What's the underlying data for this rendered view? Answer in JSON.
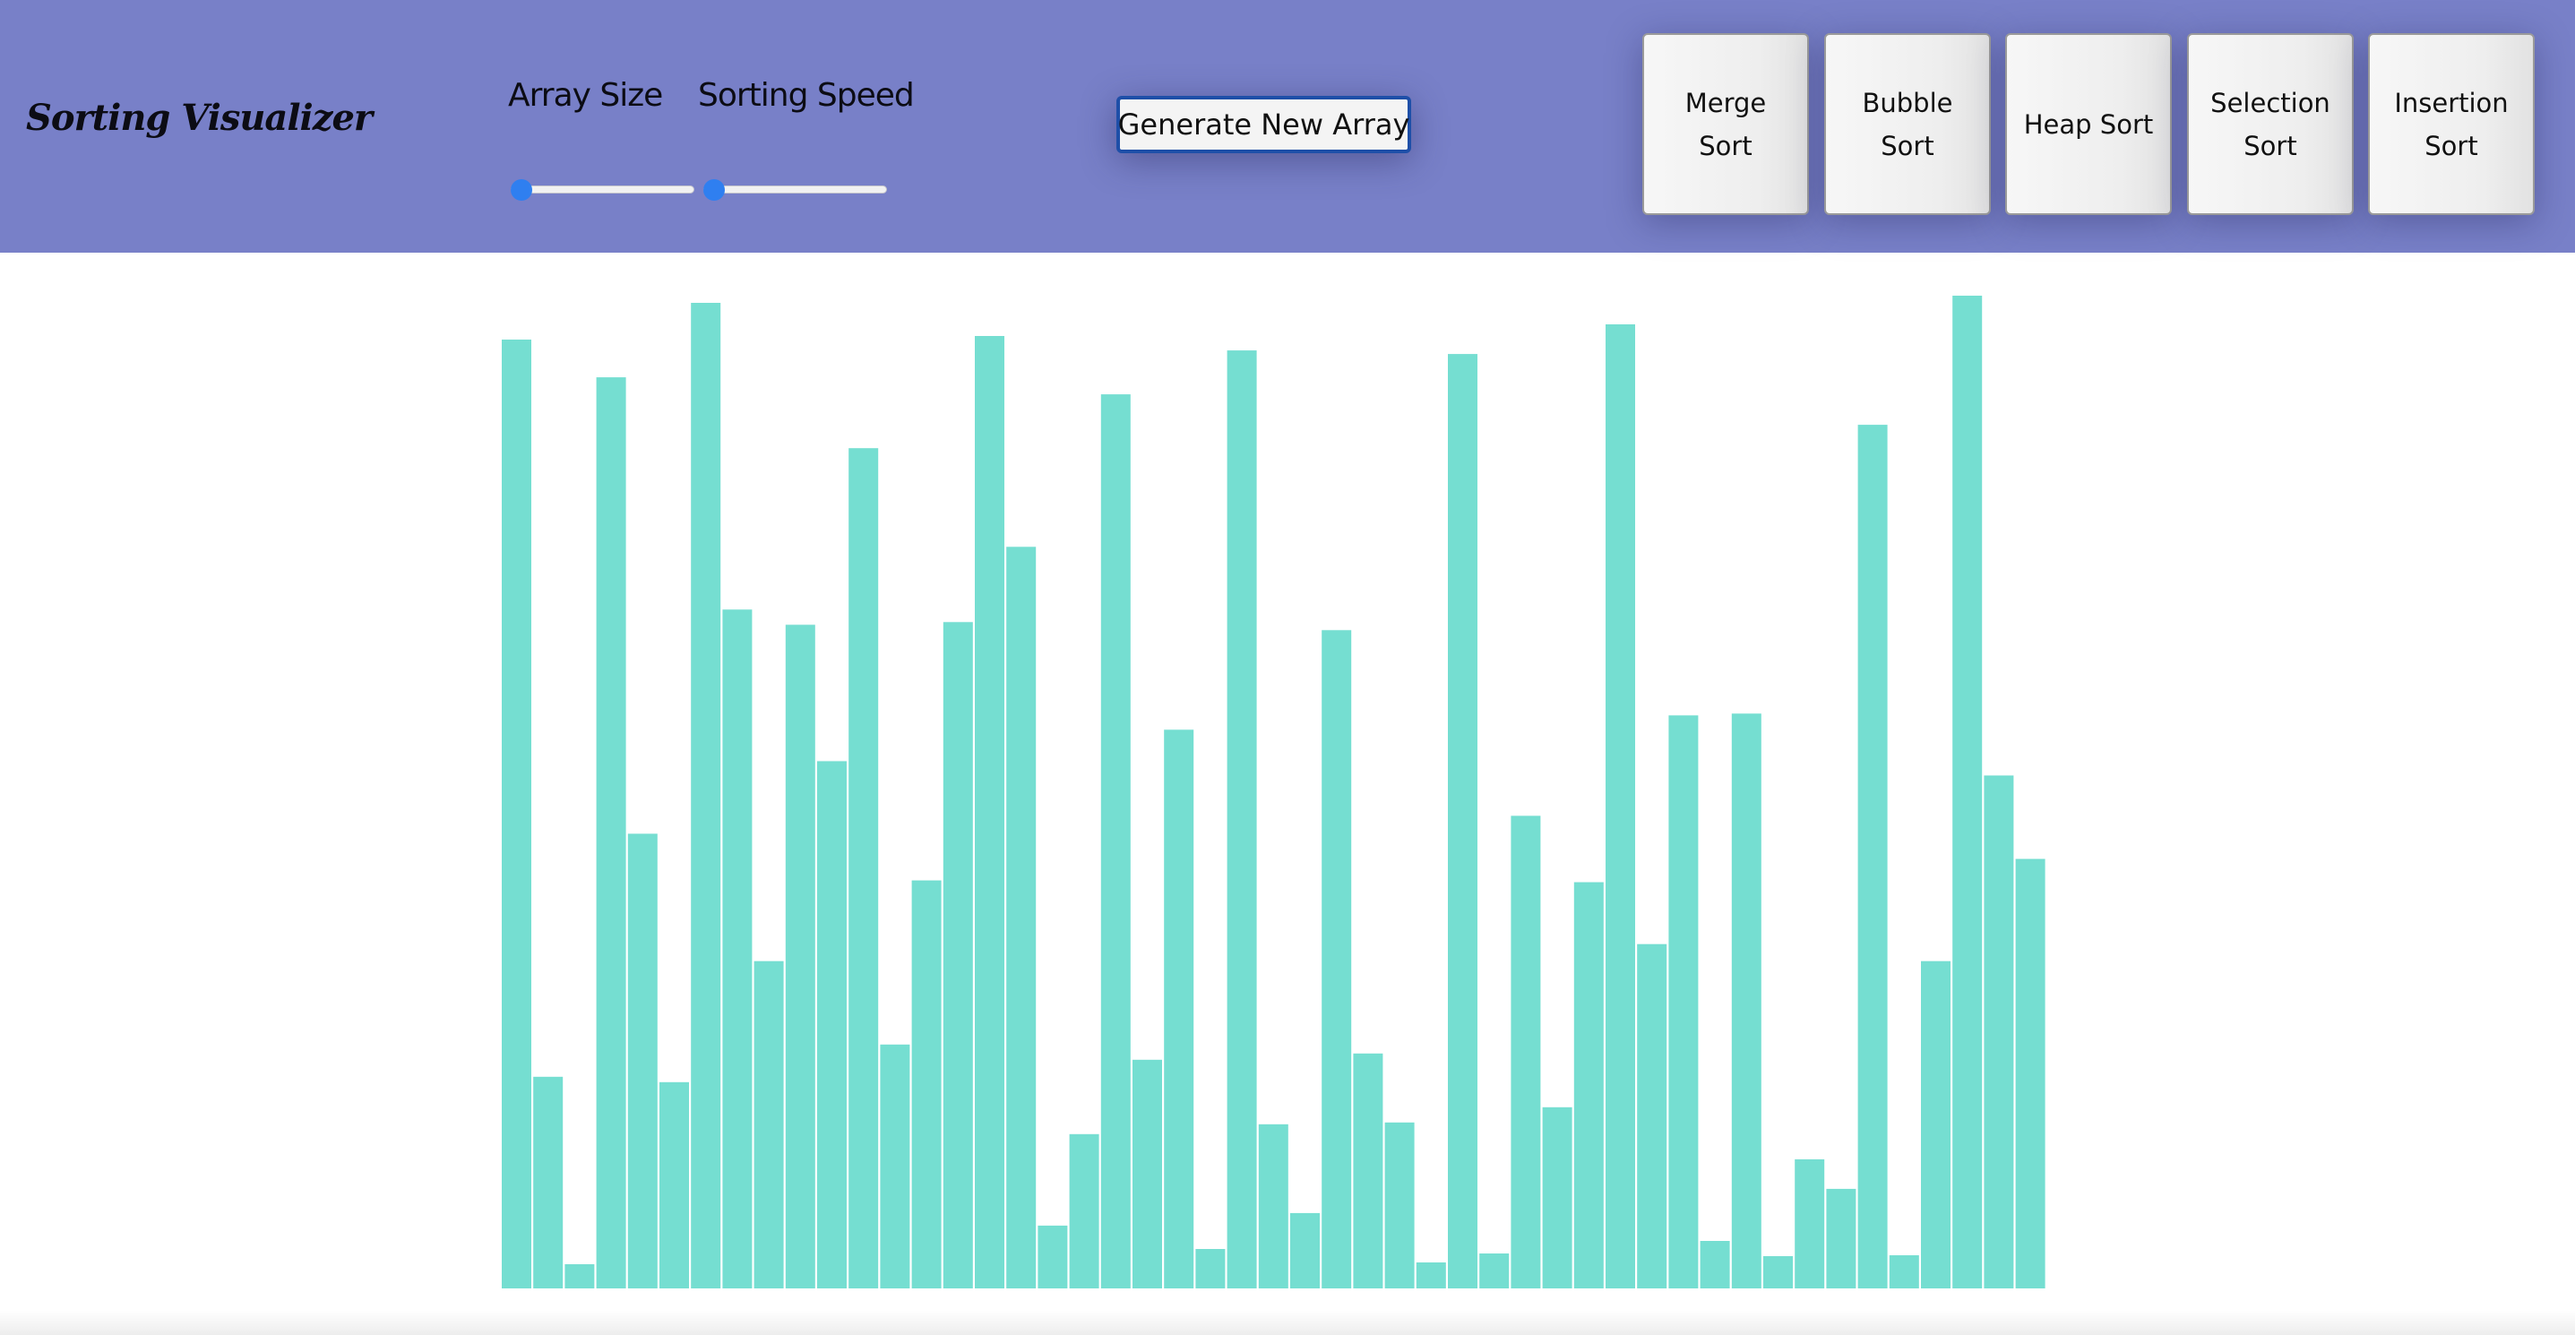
{
  "app": {
    "title": "Sorting Visualizer"
  },
  "controls": {
    "array_size": {
      "label": "Array Size",
      "value_fraction": 0.0
    },
    "sorting_speed": {
      "label": "Sorting Speed",
      "value_fraction": 0.0
    },
    "generate_label": "Generate New Array"
  },
  "algorithms": [
    {
      "label": "Merge Sort"
    },
    {
      "label": "Bubble Sort"
    },
    {
      "label": "Heap Sort"
    },
    {
      "label": "Selection Sort"
    },
    {
      "label": "Insertion Sort"
    }
  ],
  "colors": {
    "navbar": "#7880c8",
    "bar": "#75ded1",
    "slider_thumb": "#2f7ff0",
    "generate_border": "#1e4fa8"
  },
  "chart_data": {
    "type": "bar",
    "values": [
      1058,
      236,
      27,
      1016,
      507,
      230,
      1099,
      757,
      365,
      740,
      588,
      937,
      272,
      455,
      743,
      1062,
      827,
      70,
      172,
      997,
      255,
      623,
      44,
      1046,
      183,
      84,
      734,
      262,
      185,
      29,
      1042,
      39,
      527,
      202,
      453,
      1075,
      384,
      639,
      53,
      641,
      36,
      144,
      111,
      963,
      37,
      365,
      1107,
      572,
      479
    ],
    "ylim": [
      0,
      1107
    ]
  }
}
